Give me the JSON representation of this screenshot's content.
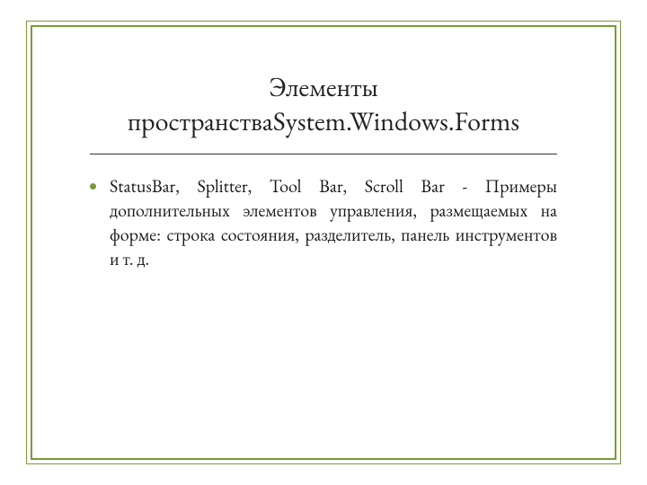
{
  "colors": {
    "accent": "#7a9a3a",
    "rule": "#333333",
    "text": "#1a1a1a"
  },
  "slide": {
    "title": "Элементы пространстваSystem.Windows.Forms",
    "bullets": [
      "StatusBar, Splitter, Tool Bar, Scroll Bar - Примеры дополнительных элементов управления, размещаемых на форме: строка состояния, разделитель, панель инструментов и т. д."
    ]
  }
}
